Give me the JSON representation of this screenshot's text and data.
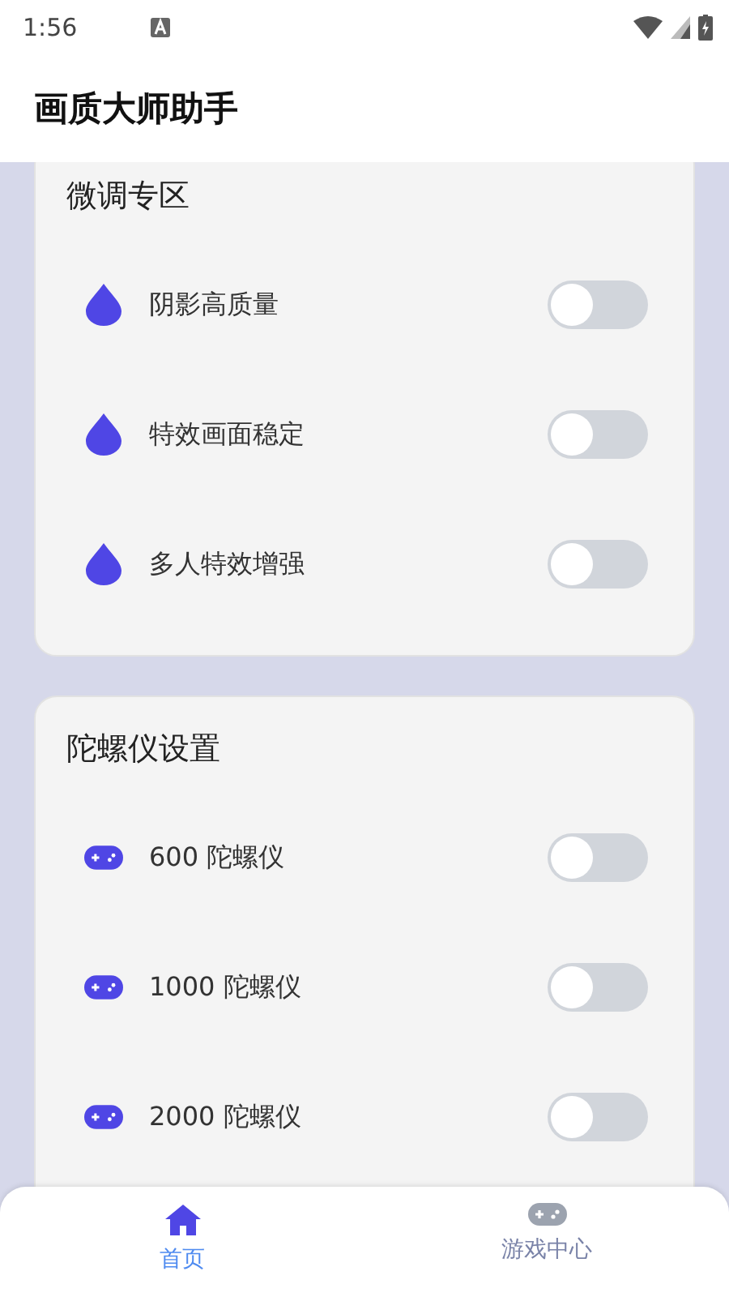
{
  "status_bar": {
    "time": "1:56"
  },
  "header": {
    "title": "画质大师助手"
  },
  "sections": [
    {
      "title": "微调专区",
      "items": [
        {
          "label": "阴影高质量",
          "on": false
        },
        {
          "label": "特效画面稳定",
          "on": false
        },
        {
          "label": "多人特效增强",
          "on": false
        }
      ]
    },
    {
      "title": "陀螺仪设置",
      "items": [
        {
          "label": "600 陀螺仪",
          "on": false
        },
        {
          "label": "1000 陀螺仪",
          "on": false
        },
        {
          "label": "2000 陀螺仪",
          "on": false
        }
      ]
    }
  ],
  "bottom_nav": [
    {
      "label": "首页",
      "selected": true
    },
    {
      "label": "游戏中心",
      "selected": false
    }
  ]
}
